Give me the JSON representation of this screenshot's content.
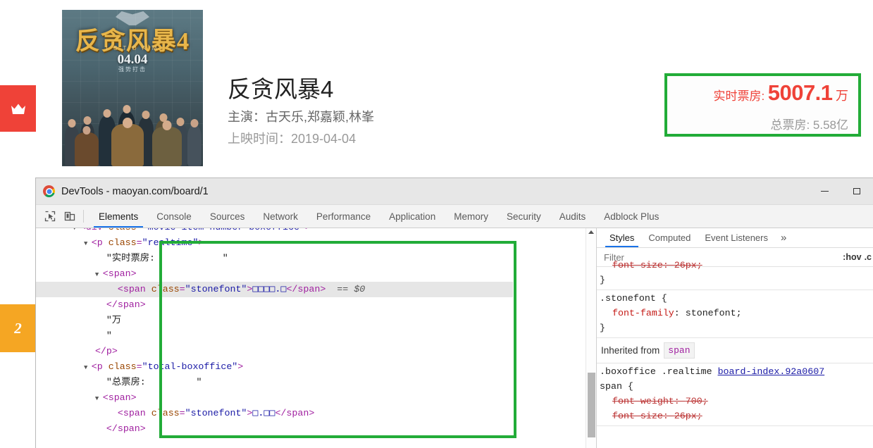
{
  "page": {
    "badges": {
      "crown_icon": "crown-icon",
      "crown_color": "#ef4238",
      "rank_number": "2",
      "rank_color": "#f5a623"
    },
    "poster": {
      "title_art": "反贪风暴4",
      "subtitle_art": "I  S T O R M",
      "release_date_art": "04.04",
      "release_tag_art": "强势打击"
    },
    "movie": {
      "title": "反贪风暴4",
      "cast_line": "主演：古天乐,郑嘉颖,林峯",
      "release_line": "上映时间：2019-04-04"
    },
    "boxoffice": {
      "realtime_label": "实时票房:",
      "realtime_value": "5007.1",
      "realtime_unit": "万",
      "total_line": "总票房: 5.58亿",
      "accent_color": "#ef4238",
      "highlight_color": "#22ac38"
    }
  },
  "devtools": {
    "window_title": "DevTools - maoyan.com/board/1",
    "logo_icon": "chrome-logo-icon",
    "window_buttons": {
      "minimize": "minimize-icon",
      "maximize": "maximize-icon"
    },
    "toolbar_icons": {
      "inspect": "inspect-element-icon",
      "device": "device-toolbar-icon"
    },
    "tabs": [
      {
        "label": "Elements",
        "active": true
      },
      {
        "label": "Console",
        "active": false
      },
      {
        "label": "Sources",
        "active": false
      },
      {
        "label": "Network",
        "active": false
      },
      {
        "label": "Performance",
        "active": false
      },
      {
        "label": "Application",
        "active": false
      },
      {
        "label": "Memory",
        "active": false
      },
      {
        "label": "Security",
        "active": false
      },
      {
        "label": "Audits",
        "active": false
      },
      {
        "label": "Adblock Plus",
        "active": false
      }
    ],
    "dom_tree": {
      "lines": [
        {
          "id": "l1",
          "indent": 0,
          "triangle": "▼",
          "parts": [
            {
              "t": "tag",
              "v": "<div "
            },
            {
              "t": "attr",
              "v": "class"
            },
            {
              "t": "tag",
              "v": "="
            },
            {
              "t": "val",
              "v": "\"movie-item-number boxoffice\""
            },
            {
              "t": "tag",
              "v": ">"
            }
          ]
        },
        {
          "id": "l2",
          "indent": 1,
          "triangle": "▼",
          "parts": [
            {
              "t": "tag",
              "v": "<p "
            },
            {
              "t": "attr",
              "v": "class"
            },
            {
              "t": "tag",
              "v": "="
            },
            {
              "t": "val",
              "v": "\"realtime\""
            },
            {
              "t": "tag",
              "v": ">"
            }
          ]
        },
        {
          "id": "l3",
          "indent": 2,
          "triangle": "",
          "parts": [
            {
              "t": "txt",
              "v": "\"实时票房:            \""
            }
          ]
        },
        {
          "id": "l4",
          "indent": 2,
          "triangle": "▼",
          "parts": [
            {
              "t": "tag",
              "v": "<span>"
            }
          ]
        },
        {
          "id": "l5",
          "indent": 3,
          "triangle": "",
          "selected": true,
          "parts": [
            {
              "t": "tag",
              "v": "<span "
            },
            {
              "t": "attr",
              "v": "class"
            },
            {
              "t": "tag",
              "v": "="
            },
            {
              "t": "val",
              "v": "\"stonefont\""
            },
            {
              "t": "tag",
              "v": ">"
            },
            {
              "t": "tofu",
              "v": "□□□□.□"
            },
            {
              "t": "tag",
              "v": "</span>"
            },
            {
              "t": "eq0",
              "v": "  == $0"
            }
          ]
        },
        {
          "id": "l6",
          "indent": 2,
          "triangle": "",
          "parts": [
            {
              "t": "tag",
              "v": "</span>"
            }
          ]
        },
        {
          "id": "l7",
          "indent": 2,
          "triangle": "",
          "parts": [
            {
              "t": "txt",
              "v": "\"万"
            }
          ]
        },
        {
          "id": "l8",
          "indent": 2,
          "triangle": "",
          "parts": [
            {
              "t": "txt",
              "v": "\""
            }
          ]
        },
        {
          "id": "l9",
          "indent": 1,
          "triangle": "",
          "parts": [
            {
              "t": "tag",
              "v": "</p>"
            }
          ]
        },
        {
          "id": "l10",
          "indent": 1,
          "triangle": "▼",
          "parts": [
            {
              "t": "tag",
              "v": "<p "
            },
            {
              "t": "attr",
              "v": "class"
            },
            {
              "t": "tag",
              "v": "="
            },
            {
              "t": "val",
              "v": "\"total-boxoffice\""
            },
            {
              "t": "tag",
              "v": ">"
            }
          ]
        },
        {
          "id": "l11",
          "indent": 2,
          "triangle": "",
          "parts": [
            {
              "t": "txt",
              "v": "\"总票房:         \""
            }
          ]
        },
        {
          "id": "l12",
          "indent": 2,
          "triangle": "▼",
          "parts": [
            {
              "t": "tag",
              "v": "<span>"
            }
          ]
        },
        {
          "id": "l13",
          "indent": 3,
          "triangle": "",
          "parts": [
            {
              "t": "tag",
              "v": "<span "
            },
            {
              "t": "attr",
              "v": "class"
            },
            {
              "t": "tag",
              "v": "="
            },
            {
              "t": "val",
              "v": "\"stonefont\""
            },
            {
              "t": "tag",
              "v": ">"
            },
            {
              "t": "tofu",
              "v": "□.□□"
            },
            {
              "t": "tag",
              "v": "</span>"
            }
          ]
        },
        {
          "id": "l14",
          "indent": 2,
          "triangle": "",
          "parts": [
            {
              "t": "tag",
              "v": "</span>"
            }
          ]
        }
      ]
    },
    "styles_panel": {
      "tabs": [
        {
          "label": "Styles",
          "active": true
        },
        {
          "label": "Computed",
          "active": false
        },
        {
          "label": "Event Listeners",
          "active": false
        }
      ],
      "more_icon": "chevron-double-right-icon",
      "filter_placeholder": "Filter",
      "filter_value": "",
      "hov_button": ":hov",
      "cls_button": ".c",
      "rules": [
        {
          "id": "r0",
          "clipped": true,
          "selector": "",
          "source": "",
          "declarations": [
            {
              "name": "font-size",
              "value": "26px",
              "struck": true
            }
          ]
        },
        {
          "id": "r1",
          "clipped": false,
          "selector": ".stonefont {",
          "source": "",
          "declarations": [
            {
              "name": "font-family",
              "value": "stonefont",
              "struck": false
            }
          ]
        }
      ],
      "inherited_label": "Inherited from",
      "inherited_tag": "span",
      "inherited_rule": {
        "selector_line1": ".boxoffice .realtime",
        "source": "board-index.92a0607",
        "selector_line2": "span {",
        "declarations": [
          {
            "name": "font-weight",
            "value": "700",
            "struck": true
          },
          {
            "name": "font-size",
            "value": "26px",
            "struck": true
          }
        ]
      }
    }
  }
}
